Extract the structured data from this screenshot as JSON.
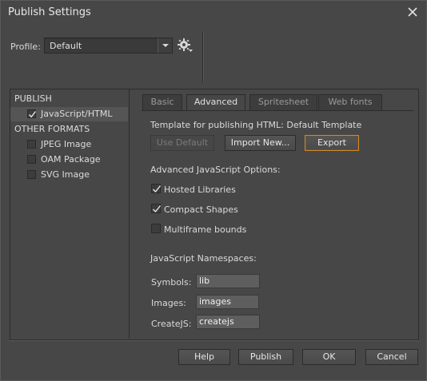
{
  "window": {
    "title": "Publish Settings"
  },
  "profile": {
    "label": "Profile:",
    "value": "Default"
  },
  "left": {
    "publish_heading": "PUBLISH",
    "publish_items": [
      {
        "label": "JavaScript/HTML",
        "checked": true
      }
    ],
    "other_heading": "OTHER FORMATS",
    "other_items": [
      {
        "label": "JPEG Image",
        "checked": false
      },
      {
        "label": "OAM Package",
        "checked": false
      },
      {
        "label": "SVG Image",
        "checked": false
      }
    ]
  },
  "tabs": [
    {
      "label": "Basic",
      "active": false
    },
    {
      "label": "Advanced",
      "active": true
    },
    {
      "label": "Spritesheet",
      "active": false
    },
    {
      "label": "Web fonts",
      "active": false
    }
  ],
  "advanced": {
    "template_text": "Template for publishing HTML: Default Template",
    "use_default": "Use Default",
    "import_new": "Import New...",
    "export": "Export",
    "js_options_heading": "Advanced JavaScript Options:",
    "options": [
      {
        "label": "Hosted Libraries",
        "checked": true
      },
      {
        "label": "Compact Shapes",
        "checked": true
      },
      {
        "label": "Multiframe bounds",
        "checked": false
      }
    ],
    "ns_heading": "JavaScript Namespaces:",
    "namespaces": [
      {
        "label": "Symbols:",
        "value": "lib"
      },
      {
        "label": "Images:",
        "value": "images"
      },
      {
        "label": "CreateJS:",
        "value": "createjs"
      }
    ]
  },
  "footer": {
    "help": "Help",
    "publish": "Publish",
    "ok": "OK",
    "cancel": "Cancel"
  }
}
